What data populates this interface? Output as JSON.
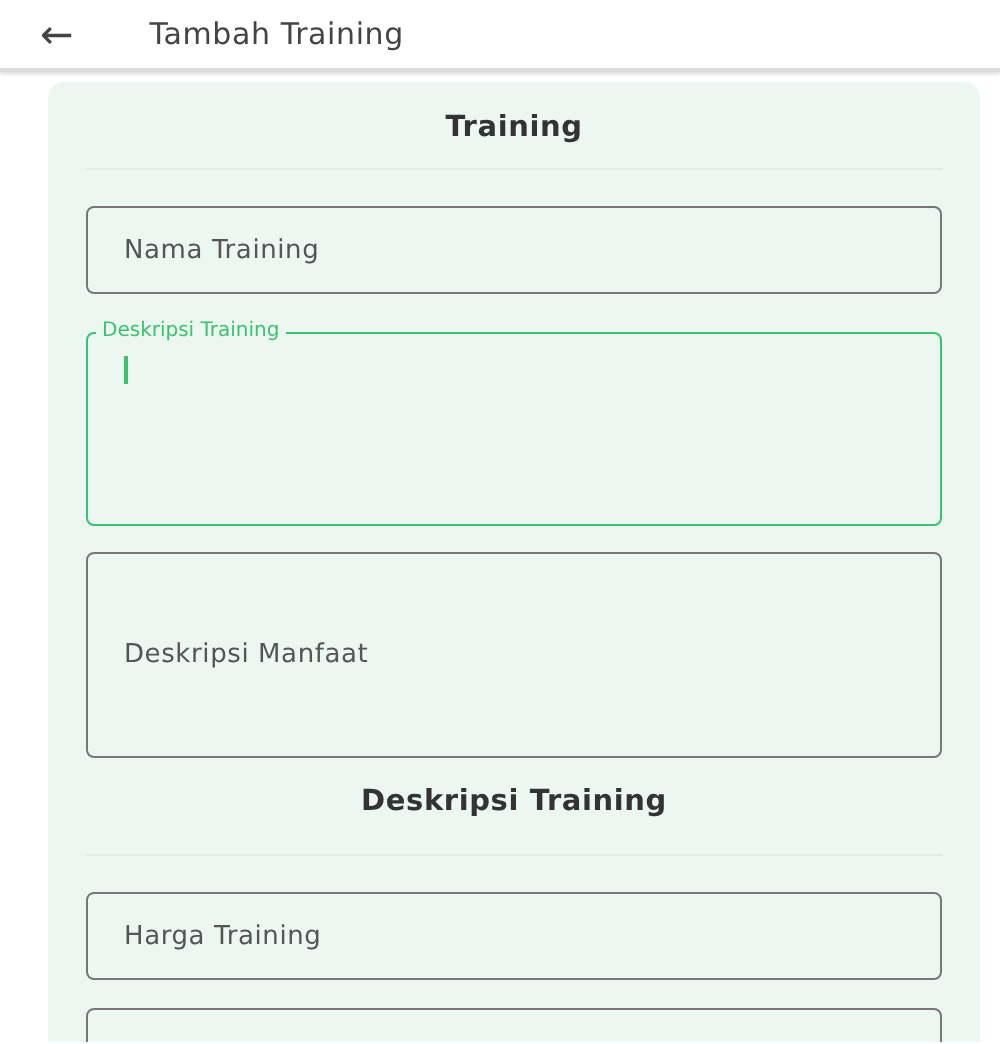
{
  "app_bar": {
    "back": "←",
    "title": "Tambah Training"
  },
  "sections": [
    {
      "title": "Training",
      "fields": [
        {
          "label": "Nama Training",
          "multiline": false,
          "focused": false
        },
        {
          "label": "Deskripsi Training",
          "multiline": true,
          "focused": true
        },
        {
          "label": "Deskripsi Manfaat",
          "multiline": true,
          "focused": false
        }
      ]
    },
    {
      "title": "Deskripsi Training",
      "fields": [
        {
          "label": "Harga Training",
          "multiline": false,
          "focused": false
        },
        {
          "focused": false
        }
      ]
    }
  ]
}
